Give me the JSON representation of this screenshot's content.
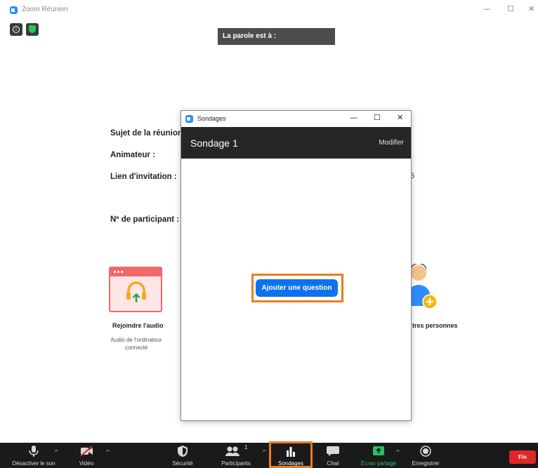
{
  "app": {
    "title": "Zoom Réunion"
  },
  "window_controls": {
    "minimize": "—",
    "maximize": "☐",
    "close": "✕"
  },
  "banner": {
    "speaking": "La parole est à :"
  },
  "meeting_info": {
    "topic_label": "Sujet de la réunion",
    "host_label": "Animateur :",
    "invite_label": "Lien d'invitation :",
    "participant_label": "Nº de participant :",
    "clipped_text": "5"
  },
  "audio": {
    "join_label": "Rejoindre l'audio",
    "sub_label": "Audio de l'ordinateur connecté"
  },
  "invite": {
    "label": "tres personnes"
  },
  "poll_window": {
    "title": "Sondages",
    "poll_name": "Sondage 1",
    "edit_label": "Modifier",
    "add_question_label": "Ajouter une question"
  },
  "toolbar": {
    "mute_label": "Désactiver le son",
    "video_label": "Vidéo",
    "security_label": "Sécurité",
    "participants_label": "Participants",
    "participants_count": "1",
    "polls_label": "Sondages",
    "chat_label": "Chat",
    "share_label": "Écran partagé",
    "record_label": "Enregistrer",
    "end_label": "Fin"
  },
  "colors": {
    "zoom_blue": "#2d8cff",
    "button_blue": "#0e72ed",
    "highlight_orange": "#f07a1e",
    "end_red": "#e02828",
    "share_green": "#23c55e",
    "toolbar_bg": "#1a1a1a"
  },
  "icons": {
    "app_logo": "zoom-logo-icon",
    "info": "info-icon",
    "security_badge": "shield-check-icon",
    "mic": "microphone-icon",
    "video": "video-off-icon",
    "security": "shield-icon",
    "participants": "people-icon",
    "polls": "bar-chart-icon",
    "chat": "chat-bubble-icon",
    "share": "share-screen-icon",
    "record": "record-icon",
    "headphones": "headphones-icon",
    "invite": "add-user-icon"
  }
}
